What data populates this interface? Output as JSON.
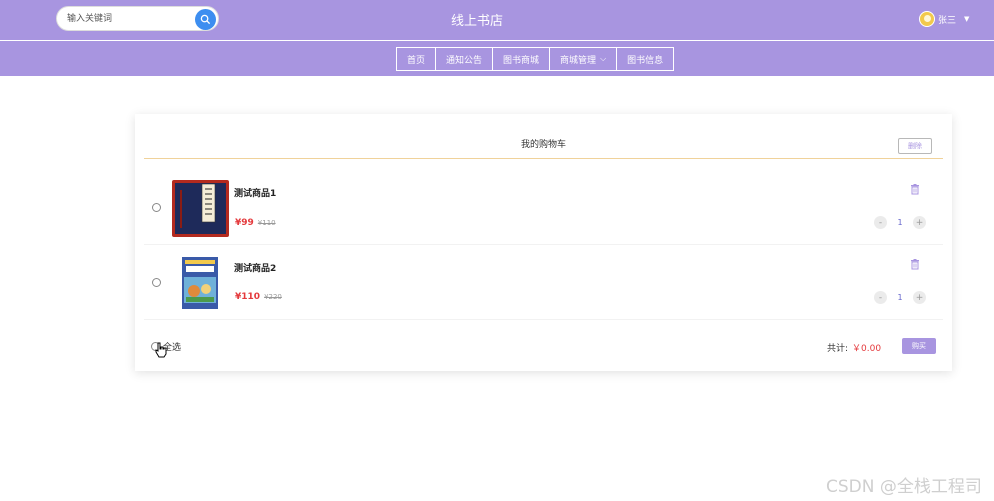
{
  "header": {
    "search_placeholder": "输入关键词",
    "title": "线上书店",
    "username": "张三"
  },
  "nav": {
    "items": [
      "首页",
      "通知公告",
      "图书商城",
      "商城管理",
      "图书信息"
    ]
  },
  "cart": {
    "title": "我的购物车",
    "delete_label": "删除",
    "items": [
      {
        "name": "测试商品1",
        "price": "¥99",
        "original_price": "¥110",
        "quantity": "1"
      },
      {
        "name": "测试商品2",
        "price": "¥110",
        "original_price": "¥220",
        "quantity": "1"
      }
    ],
    "select_all_label": "全选",
    "total_label": "共计:",
    "total_value": "￥0.00",
    "buy_label": "购买"
  },
  "watermark": "CSDN @全栈工程司",
  "colors": {
    "brand": "#a895e0",
    "search_button": "#3d8ef0",
    "price": "#e4393c"
  }
}
